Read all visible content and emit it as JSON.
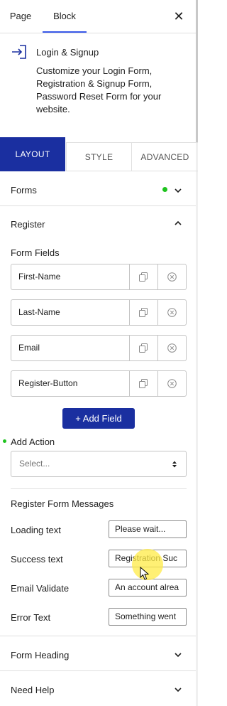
{
  "header": {
    "tabs": [
      "Page",
      "Block"
    ],
    "active_tab": "Block"
  },
  "block": {
    "title": "Login & Signup",
    "description": "Customize your Login Form, Registration & Signup Form, Password Reset Form for your website.",
    "icon": "login-icon"
  },
  "layout_tabs": [
    "LAYOUT",
    "STYLE",
    "ADVANCED"
  ],
  "panels": {
    "forms": "Forms",
    "register": "Register",
    "form_heading": "Form Heading",
    "need_help": "Need Help"
  },
  "register": {
    "form_fields_label": "Form Fields",
    "fields": [
      "First-Name",
      "Last-Name",
      "Email",
      "Register-Button"
    ],
    "add_field_label": "+ Add Field",
    "add_action_label": "Add Action",
    "add_action_placeholder": "Select...",
    "messages_heading": "Register Form Messages",
    "messages": [
      {
        "label": "Loading text",
        "value": "Please wait..."
      },
      {
        "label": "Success text",
        "value": "Registration Suc"
      },
      {
        "label": "Email Validate",
        "value": "An account alrea"
      },
      {
        "label": "Error Text",
        "value": "Something went"
      }
    ]
  },
  "colors": {
    "accent": "#1a2fa0",
    "tab_underline": "#3858e9",
    "status_dot": "#1ec31e"
  }
}
